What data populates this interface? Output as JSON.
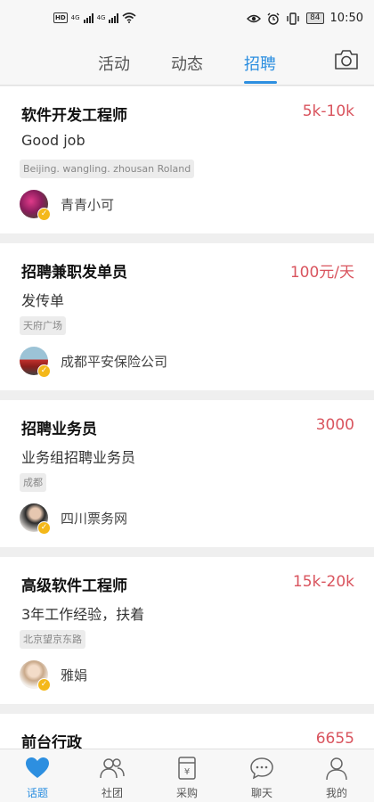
{
  "status_bar": {
    "hd_label": "HD",
    "signal1": "4G",
    "signal2": "4G",
    "battery": "84",
    "time": "10:50"
  },
  "top_tabs": [
    {
      "label": "活动",
      "active": false
    },
    {
      "label": "动态",
      "active": false
    },
    {
      "label": "招聘",
      "active": true
    }
  ],
  "jobs": [
    {
      "title": "软件开发工程师",
      "salary": "5k-10k",
      "desc": "Good job",
      "location": "Beijing. wangling. zhousan Roland",
      "poster": "青青小可",
      "avatar_icon": "flower-avatar"
    },
    {
      "title": "招聘兼职发单员",
      "salary": "100元/天",
      "desc": "发传单",
      "location": "天府广场",
      "poster": "成都平安保险公司",
      "avatar_icon": "car-avatar"
    },
    {
      "title": "招聘业务员",
      "salary": "3000",
      "desc": "业务组招聘业务员",
      "location": "成都",
      "poster": "四川票务网",
      "avatar_icon": "person-avatar"
    },
    {
      "title": "高级软件工程师",
      "salary": "15k-20k",
      "desc": "3年工作经验，扶着",
      "location": "北京望京东路",
      "poster": "雅娟",
      "avatar_icon": "girl-avatar"
    },
    {
      "title": "前台行政",
      "salary": "6655",
      "desc": "",
      "location": "",
      "poster": "",
      "avatar_icon": ""
    }
  ],
  "bottom_nav": [
    {
      "label": "话题",
      "icon": "heart-icon",
      "active": true
    },
    {
      "label": "社团",
      "icon": "group-icon",
      "active": false
    },
    {
      "label": "采购",
      "icon": "purchase-icon",
      "active": false
    },
    {
      "label": "聊天",
      "icon": "chat-icon",
      "active": false
    },
    {
      "label": "我的",
      "icon": "profile-icon",
      "active": false
    }
  ],
  "colors": {
    "accent": "#2d8fe0",
    "salary": "#d9545e",
    "verified_badge": "#f4b81a"
  }
}
